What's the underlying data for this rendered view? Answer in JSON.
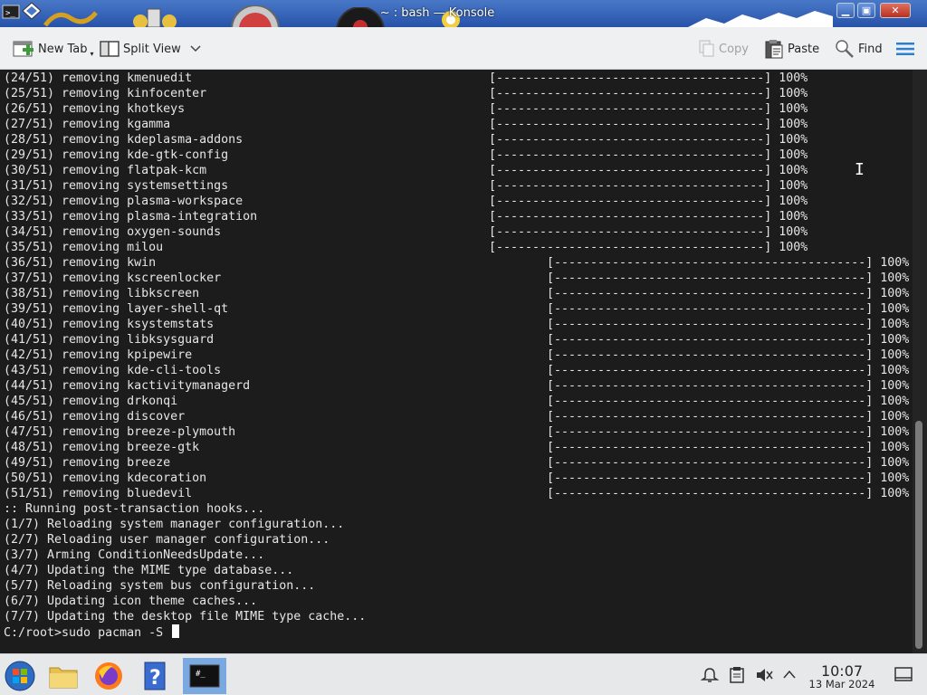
{
  "window": {
    "title": "~ : bash — Konsole",
    "controls": {
      "minimize": "▁",
      "maximize": "▣",
      "close": "✕"
    }
  },
  "toolbar": {
    "new_tab": "New Tab",
    "split_view": "Split View",
    "copy": "Copy",
    "paste": "Paste",
    "find": "Find"
  },
  "terminal": {
    "bar_short": "[-------------------------------------]",
    "bar_long": "[-------------------------------------------]",
    "pct": "100%",
    "removals": [
      {
        "label": "(24/51) removing kmenuedit"
      },
      {
        "label": "(25/51) removing kinfocenter"
      },
      {
        "label": "(26/51) removing khotkeys"
      },
      {
        "label": "(27/51) removing kgamma"
      },
      {
        "label": "(28/51) removing kdeplasma-addons"
      },
      {
        "label": "(29/51) removing kde-gtk-config"
      },
      {
        "label": "(30/51) removing flatpak-kcm"
      },
      {
        "label": "(31/51) removing systemsettings"
      },
      {
        "label": "(32/51) removing plasma-workspace"
      },
      {
        "label": "(33/51) removing plasma-integration"
      },
      {
        "label": "(34/51) removing oxygen-sounds"
      },
      {
        "label": "(35/51) removing milou"
      },
      {
        "label": "(36/51) removing kwin"
      },
      {
        "label": "(37/51) removing kscreenlocker"
      },
      {
        "label": "(38/51) removing libkscreen"
      },
      {
        "label": "(39/51) removing layer-shell-qt"
      },
      {
        "label": "(40/51) removing ksystemstats"
      },
      {
        "label": "(41/51) removing libksysguard"
      },
      {
        "label": "(42/51) removing kpipewire"
      },
      {
        "label": "(43/51) removing kde-cli-tools"
      },
      {
        "label": "(44/51) removing kactivitymanagerd"
      },
      {
        "label": "(45/51) removing drkonqi"
      },
      {
        "label": "(46/51) removing discover"
      },
      {
        "label": "(47/51) removing breeze-plymouth"
      },
      {
        "label": "(48/51) removing breeze-gtk"
      },
      {
        "label": "(49/51) removing breeze"
      },
      {
        "label": "(50/51) removing kdecoration"
      },
      {
        "label": "(51/51) removing bluedevil"
      }
    ],
    "hooks": [
      ":: Running post-transaction hooks...",
      "(1/7) Reloading system manager configuration...",
      "(2/7) Reloading user manager configuration...",
      "(3/7) Arming ConditionNeedsUpdate...",
      "(4/7) Updating the MIME type database...",
      "(5/7) Reloading system bus configuration...",
      "(6/7) Updating icon theme caches...",
      "(7/7) Updating the desktop file MIME type cache..."
    ],
    "prompt": "C:/root>sudo pacman -S "
  },
  "taskbar": {
    "clock_time": "10:07",
    "clock_date": "13 Mar 2024",
    "konsole_label": "#_"
  },
  "colors": {
    "terminal_bg": "#1c1c1c",
    "terminal_fg": "#e6e6e6",
    "toolbar_bg": "#eff0f1",
    "accent": "#3daee9"
  }
}
